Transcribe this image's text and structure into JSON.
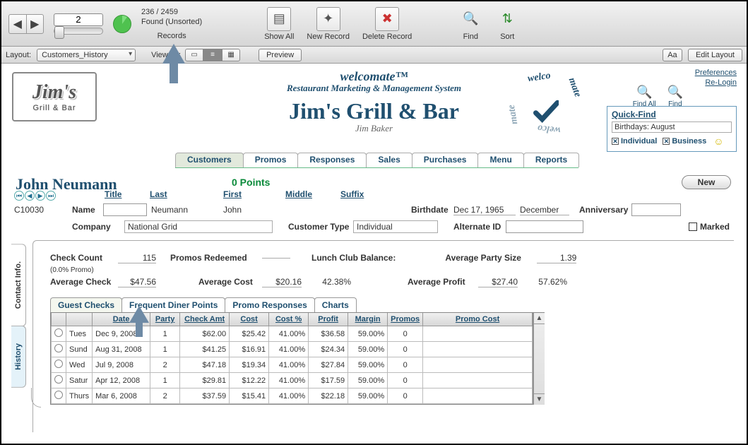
{
  "toolbar": {
    "record_number": "2",
    "found": "236 / 2459",
    "found_sub": "Found (Unsorted)",
    "records_label": "Records",
    "show_all": "Show All",
    "new_record": "New Record",
    "delete_record": "Delete Record",
    "find": "Find",
    "sort": "Sort",
    "layout_label": "Layout:",
    "layout_value": "Customers_History",
    "view_as_label": "View As:",
    "preview": "Preview",
    "aa": "Aa",
    "edit_layout": "Edit Layout"
  },
  "header": {
    "brand_top": "welcomate™",
    "brand_line": "Restaurant Marketing & Management System",
    "company": "Jim's Grill & Bar",
    "owner": "Jim Baker",
    "logo_main": "Jim's",
    "logo_sub": "Grill & Bar",
    "pref": "Preferences",
    "relogin": "Re-Login",
    "findall": "Find All",
    "find": "Find"
  },
  "quickfind": {
    "title": "Quick-Find",
    "row": "Birthdays:  August",
    "individual": "Individual",
    "business": "Business"
  },
  "maintabs": [
    "Customers",
    "Promos",
    "Responses",
    "Sales",
    "Purchases",
    "Menu",
    "Reports"
  ],
  "customer": {
    "name": "John  Neumann",
    "points": "0  Points",
    "id": "C10030",
    "labels": {
      "title": "Title",
      "last": "Last",
      "first": "First",
      "middle": "Middle",
      "suffix": "Suffix",
      "name": "Name",
      "birthdate": "Birthdate",
      "anniversary": "Anniversary",
      "company": "Company",
      "custtype": "Customer Type",
      "altid": "Alternate ID",
      "marked": "Marked",
      "month": "December"
    },
    "last": "Neumann",
    "first": "John",
    "birthdate": "Dec 17, 1965",
    "company": "National Grid",
    "custtype": "Individual",
    "new_btn": "New"
  },
  "sidetabs": {
    "contact": "Contact Info.",
    "history": "History"
  },
  "stats": {
    "check_count_lbl": "Check Count",
    "check_count": "115",
    "promo_note": "(0.0% Promo)",
    "promos_redeemed": "Promos Redeemed",
    "lunch_club": "Lunch Club Balance:",
    "avg_party_lbl": "Average Party Size",
    "avg_party": "1.39",
    "avg_check_lbl": "Average Check",
    "avg_check": "$47.56",
    "avg_cost_lbl": "Average Cost",
    "avg_cost": "$20.16",
    "avg_cost_pct": "42.38%",
    "avg_profit_lbl": "Average Profit",
    "avg_profit": "$27.40",
    "avg_profit_pct": "57.62%"
  },
  "innertabs": [
    "Guest Checks",
    "Frequent Diner Points",
    "Promo Responses",
    "Charts"
  ],
  "table": {
    "headers": [
      "",
      "Date",
      "Party",
      "Check Amt",
      "Cost",
      "Cost %",
      "Profit",
      "Margin",
      "Promos",
      "Promo Cost"
    ],
    "rows": [
      {
        "day": "Tues",
        "date": "Dec 9, 2008",
        "party": "1",
        "amt": "$62.00",
        "cost": "$25.42",
        "costp": "41.00%",
        "profit": "$36.58",
        "margin": "59.00%",
        "promos": "0",
        "pcost": ""
      },
      {
        "day": "Sund",
        "date": "Aug 31, 2008",
        "party": "1",
        "amt": "$41.25",
        "cost": "$16.91",
        "costp": "41.00%",
        "profit": "$24.34",
        "margin": "59.00%",
        "promos": "0",
        "pcost": ""
      },
      {
        "day": "Wed",
        "date": "Jul 9, 2008",
        "party": "2",
        "amt": "$47.18",
        "cost": "$19.34",
        "costp": "41.00%",
        "profit": "$27.84",
        "margin": "59.00%",
        "promos": "0",
        "pcost": ""
      },
      {
        "day": "Satur",
        "date": "Apr 12, 2008",
        "party": "1",
        "amt": "$29.81",
        "cost": "$12.22",
        "costp": "41.00%",
        "profit": "$17.59",
        "margin": "59.00%",
        "promos": "0",
        "pcost": ""
      },
      {
        "day": "Thurs",
        "date": "Mar 6, 2008",
        "party": "2",
        "amt": "$37.59",
        "cost": "$15.41",
        "costp": "41.00%",
        "profit": "$22.18",
        "margin": "59.00%",
        "promos": "0",
        "pcost": ""
      }
    ]
  }
}
